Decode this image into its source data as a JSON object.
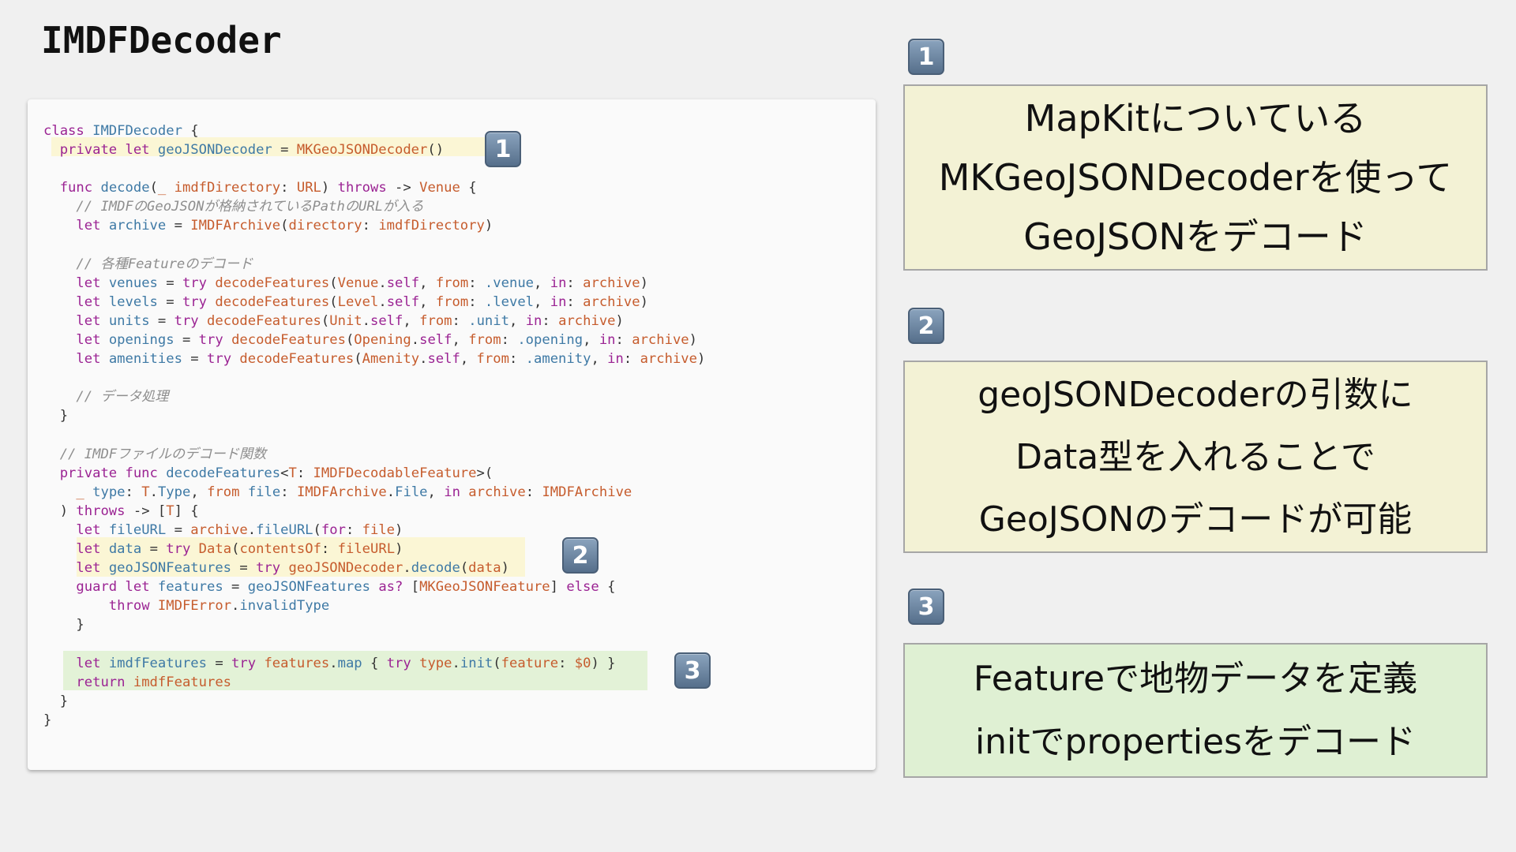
{
  "slide": {
    "title": "IMDFDecoder"
  },
  "badges": [
    "1",
    "2",
    "3"
  ],
  "code": {
    "lines": [
      [
        [
          "kw",
          "class"
        ],
        [
          "pl",
          " "
        ],
        [
          "ty",
          "IMDFDecoder"
        ],
        [
          "pl",
          " {"
        ]
      ],
      [
        [
          "pl",
          "  "
        ],
        [
          "kw",
          "private let"
        ],
        [
          "pl",
          " "
        ],
        [
          "ty",
          "geoJSONDecoder"
        ],
        [
          "pl",
          " = "
        ],
        [
          "fn",
          "MKGeoJSONDecoder"
        ],
        [
          "pl",
          "()"
        ]
      ],
      [],
      [
        [
          "pl",
          "  "
        ],
        [
          "kw",
          "func"
        ],
        [
          "pl",
          " "
        ],
        [
          "ty",
          "decode"
        ],
        [
          "pl",
          "("
        ],
        [
          "fn",
          "_ imdfDirectory"
        ],
        [
          "pl",
          ": "
        ],
        [
          "fn",
          "URL"
        ],
        [
          "pl",
          ") "
        ],
        [
          "kw",
          "throws"
        ],
        [
          "pl",
          " -> "
        ],
        [
          "fn",
          "Venue"
        ],
        [
          "pl",
          " {"
        ]
      ],
      [
        [
          "pl",
          "    "
        ],
        [
          "cm",
          "// IMDFのGeoJSONが格納されているPathのURLが入る"
        ]
      ],
      [
        [
          "pl",
          "    "
        ],
        [
          "kw",
          "let"
        ],
        [
          "pl",
          " "
        ],
        [
          "ty",
          "archive"
        ],
        [
          "pl",
          " = "
        ],
        [
          "fn",
          "IMDFArchive"
        ],
        [
          "pl",
          "("
        ],
        [
          "fn",
          "directory"
        ],
        [
          "pl",
          ": "
        ],
        [
          "fn",
          "imdfDirectory"
        ],
        [
          "pl",
          ")"
        ]
      ],
      [],
      [
        [
          "pl",
          "    "
        ],
        [
          "cm",
          "// 各種Featureのデコード"
        ]
      ],
      [
        [
          "pl",
          "    "
        ],
        [
          "kw",
          "let"
        ],
        [
          "pl",
          " "
        ],
        [
          "ty",
          "venues"
        ],
        [
          "pl",
          " = "
        ],
        [
          "kw",
          "try"
        ],
        [
          "pl",
          " "
        ],
        [
          "fn",
          "decodeFeatures"
        ],
        [
          "pl",
          "("
        ],
        [
          "fn",
          "Venue"
        ],
        [
          "pl",
          "."
        ],
        [
          "kw",
          "self"
        ],
        [
          "pl",
          ", "
        ],
        [
          "fn",
          "from"
        ],
        [
          "pl",
          ": "
        ],
        [
          "ty",
          ".venue"
        ],
        [
          "pl",
          ", "
        ],
        [
          "kw",
          "in"
        ],
        [
          "pl",
          ": "
        ],
        [
          "fn",
          "archive"
        ],
        [
          "pl",
          ")"
        ]
      ],
      [
        [
          "pl",
          "    "
        ],
        [
          "kw",
          "let"
        ],
        [
          "pl",
          " "
        ],
        [
          "ty",
          "levels"
        ],
        [
          "pl",
          " = "
        ],
        [
          "kw",
          "try"
        ],
        [
          "pl",
          " "
        ],
        [
          "fn",
          "decodeFeatures"
        ],
        [
          "pl",
          "("
        ],
        [
          "fn",
          "Level"
        ],
        [
          "pl",
          "."
        ],
        [
          "kw",
          "self"
        ],
        [
          "pl",
          ", "
        ],
        [
          "fn",
          "from"
        ],
        [
          "pl",
          ": "
        ],
        [
          "ty",
          ".level"
        ],
        [
          "pl",
          ", "
        ],
        [
          "kw",
          "in"
        ],
        [
          "pl",
          ": "
        ],
        [
          "fn",
          "archive"
        ],
        [
          "pl",
          ")"
        ]
      ],
      [
        [
          "pl",
          "    "
        ],
        [
          "kw",
          "let"
        ],
        [
          "pl",
          " "
        ],
        [
          "ty",
          "units"
        ],
        [
          "pl",
          " = "
        ],
        [
          "kw",
          "try"
        ],
        [
          "pl",
          " "
        ],
        [
          "fn",
          "decodeFeatures"
        ],
        [
          "pl",
          "("
        ],
        [
          "fn",
          "Unit"
        ],
        [
          "pl",
          "."
        ],
        [
          "kw",
          "self"
        ],
        [
          "pl",
          ", "
        ],
        [
          "fn",
          "from"
        ],
        [
          "pl",
          ": "
        ],
        [
          "ty",
          ".unit"
        ],
        [
          "pl",
          ", "
        ],
        [
          "kw",
          "in"
        ],
        [
          "pl",
          ": "
        ],
        [
          "fn",
          "archive"
        ],
        [
          "pl",
          ")"
        ]
      ],
      [
        [
          "pl",
          "    "
        ],
        [
          "kw",
          "let"
        ],
        [
          "pl",
          " "
        ],
        [
          "ty",
          "openings"
        ],
        [
          "pl",
          " = "
        ],
        [
          "kw",
          "try"
        ],
        [
          "pl",
          " "
        ],
        [
          "fn",
          "decodeFeatures"
        ],
        [
          "pl",
          "("
        ],
        [
          "fn",
          "Opening"
        ],
        [
          "pl",
          "."
        ],
        [
          "kw",
          "self"
        ],
        [
          "pl",
          ", "
        ],
        [
          "fn",
          "from"
        ],
        [
          "pl",
          ": "
        ],
        [
          "ty",
          ".opening"
        ],
        [
          "pl",
          ", "
        ],
        [
          "kw",
          "in"
        ],
        [
          "pl",
          ": "
        ],
        [
          "fn",
          "archive"
        ],
        [
          "pl",
          ")"
        ]
      ],
      [
        [
          "pl",
          "    "
        ],
        [
          "kw",
          "let"
        ],
        [
          "pl",
          " "
        ],
        [
          "ty",
          "amenities"
        ],
        [
          "pl",
          " = "
        ],
        [
          "kw",
          "try"
        ],
        [
          "pl",
          " "
        ],
        [
          "fn",
          "decodeFeatures"
        ],
        [
          "pl",
          "("
        ],
        [
          "fn",
          "Amenity"
        ],
        [
          "pl",
          "."
        ],
        [
          "kw",
          "self"
        ],
        [
          "pl",
          ", "
        ],
        [
          "fn",
          "from"
        ],
        [
          "pl",
          ": "
        ],
        [
          "ty",
          ".amenity"
        ],
        [
          "pl",
          ", "
        ],
        [
          "kw",
          "in"
        ],
        [
          "pl",
          ": "
        ],
        [
          "fn",
          "archive"
        ],
        [
          "pl",
          ")"
        ]
      ],
      [],
      [
        [
          "pl",
          "    "
        ],
        [
          "cm",
          "// データ処理"
        ]
      ],
      [
        [
          "pl",
          "  }"
        ]
      ],
      [],
      [
        [
          "pl",
          "  "
        ],
        [
          "cm",
          "// IMDFファイルのデコード関数"
        ]
      ],
      [
        [
          "pl",
          "  "
        ],
        [
          "kw",
          "private func"
        ],
        [
          "pl",
          " "
        ],
        [
          "ty",
          "decodeFeatures"
        ],
        [
          "pl",
          "<"
        ],
        [
          "fn",
          "T"
        ],
        [
          "pl",
          ": "
        ],
        [
          "fn",
          "IMDFDecodableFeature"
        ],
        [
          "pl",
          ">("
        ]
      ],
      [
        [
          "pl",
          "    "
        ],
        [
          "fn",
          "_"
        ],
        [
          "pl",
          " "
        ],
        [
          "ty",
          "type"
        ],
        [
          "pl",
          ": "
        ],
        [
          "fn",
          "T"
        ],
        [
          "pl",
          "."
        ],
        [
          "ty",
          "Type"
        ],
        [
          "pl",
          ", "
        ],
        [
          "fn",
          "from"
        ],
        [
          "pl",
          " "
        ],
        [
          "ty",
          "file"
        ],
        [
          "pl",
          ": "
        ],
        [
          "fn",
          "IMDFArchive"
        ],
        [
          "pl",
          "."
        ],
        [
          "ty",
          "File"
        ],
        [
          "pl",
          ", "
        ],
        [
          "kw",
          "in"
        ],
        [
          "pl",
          " "
        ],
        [
          "fn",
          "archive"
        ],
        [
          "pl",
          ": "
        ],
        [
          "fn",
          "IMDFArchive"
        ]
      ],
      [
        [
          "pl",
          "  ) "
        ],
        [
          "kw",
          "throws"
        ],
        [
          "pl",
          " -> ["
        ],
        [
          "fn",
          "T"
        ],
        [
          "pl",
          "] {"
        ]
      ],
      [
        [
          "pl",
          "    "
        ],
        [
          "kw",
          "let"
        ],
        [
          "pl",
          " "
        ],
        [
          "ty",
          "fileURL"
        ],
        [
          "pl",
          " = "
        ],
        [
          "fn",
          "archive"
        ],
        [
          "pl",
          "."
        ],
        [
          "ty",
          "fileURL"
        ],
        [
          "pl",
          "("
        ],
        [
          "kw",
          "for"
        ],
        [
          "pl",
          ": "
        ],
        [
          "fn",
          "file"
        ],
        [
          "pl",
          ")"
        ]
      ],
      [
        [
          "pl",
          "    "
        ],
        [
          "kw",
          "let"
        ],
        [
          "pl",
          " "
        ],
        [
          "ty",
          "data"
        ],
        [
          "pl",
          " = "
        ],
        [
          "kw",
          "try"
        ],
        [
          "pl",
          " "
        ],
        [
          "fn",
          "Data"
        ],
        [
          "pl",
          "("
        ],
        [
          "fn",
          "contentsOf"
        ],
        [
          "pl",
          ": "
        ],
        [
          "fn",
          "fileURL"
        ],
        [
          "pl",
          ")"
        ]
      ],
      [
        [
          "pl",
          "    "
        ],
        [
          "kw",
          "let"
        ],
        [
          "pl",
          " "
        ],
        [
          "ty",
          "geoJSONFeatures"
        ],
        [
          "pl",
          " = "
        ],
        [
          "kw",
          "try"
        ],
        [
          "pl",
          " "
        ],
        [
          "fn",
          "geoJSONDecoder"
        ],
        [
          "pl",
          "."
        ],
        [
          "ty",
          "decode"
        ],
        [
          "pl",
          "("
        ],
        [
          "fn",
          "data"
        ],
        [
          "pl",
          ")"
        ]
      ],
      [
        [
          "pl",
          "    "
        ],
        [
          "kw",
          "guard let"
        ],
        [
          "pl",
          " "
        ],
        [
          "ty",
          "features"
        ],
        [
          "pl",
          " = "
        ],
        [
          "ty",
          "geoJSONFeatures"
        ],
        [
          "pl",
          " "
        ],
        [
          "kw",
          "as?"
        ],
        [
          "pl",
          " ["
        ],
        [
          "fn",
          "MKGeoJSONFeature"
        ],
        [
          "pl",
          "] "
        ],
        [
          "kw",
          "else"
        ],
        [
          "pl",
          " {"
        ]
      ],
      [
        [
          "pl",
          "        "
        ],
        [
          "kw",
          "throw"
        ],
        [
          "pl",
          " "
        ],
        [
          "fn",
          "IMDFError"
        ],
        [
          "pl",
          "."
        ],
        [
          "ty",
          "invalidType"
        ]
      ],
      [
        [
          "pl",
          "    }"
        ]
      ],
      [],
      [
        [
          "pl",
          "    "
        ],
        [
          "kw",
          "let"
        ],
        [
          "pl",
          " "
        ],
        [
          "ty",
          "imdfFeatures"
        ],
        [
          "pl",
          " = "
        ],
        [
          "kw",
          "try"
        ],
        [
          "pl",
          " "
        ],
        [
          "fn",
          "features"
        ],
        [
          "pl",
          "."
        ],
        [
          "ty",
          "map"
        ],
        [
          "pl",
          " { "
        ],
        [
          "kw",
          "try"
        ],
        [
          "pl",
          " "
        ],
        [
          "fn",
          "type"
        ],
        [
          "pl",
          "."
        ],
        [
          "ty",
          "init"
        ],
        [
          "pl",
          "("
        ],
        [
          "fn",
          "feature"
        ],
        [
          "pl",
          ": "
        ],
        [
          "fn",
          "$0"
        ],
        [
          "pl",
          ") }"
        ]
      ],
      [
        [
          "pl",
          "    "
        ],
        [
          "kw",
          "return"
        ],
        [
          "pl",
          " "
        ],
        [
          "fn",
          "imdfFeatures"
        ]
      ],
      [
        [
          "pl",
          "  }"
        ]
      ],
      [
        [
          "pl",
          "}"
        ]
      ]
    ]
  },
  "notes": [
    {
      "lines": [
        "MapKitについている",
        "MKGeoJSONDecoderを使って",
        "GeoJSONをデコード"
      ]
    },
    {
      "lines": [
        "geoJSONDecoderの引数に",
        "Data型を入れることで",
        "GeoJSONのデコードが可能"
      ]
    },
    {
      "lines": [
        "Featureで地物データを定義",
        "initでpropertiesをデコード"
      ]
    }
  ]
}
